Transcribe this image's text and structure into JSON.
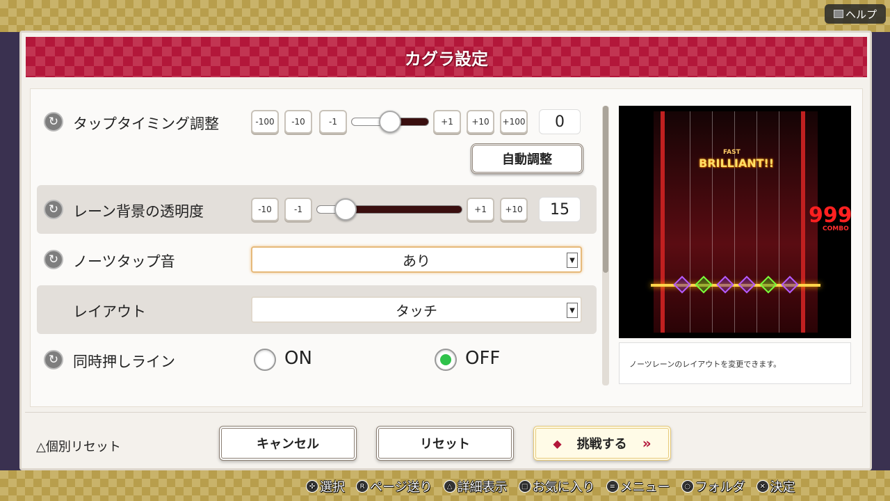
{
  "header": {
    "help_label": "ヘルプ"
  },
  "dialog": {
    "title": "カグラ設定"
  },
  "settings": {
    "tap_timing": {
      "label": "タップタイミング調整",
      "buttons": [
        "-100",
        "-10",
        "-1",
        "+1",
        "+10",
        "+100"
      ],
      "value": "0",
      "slider_fraction": 0.5,
      "auto_button": "自動調整"
    },
    "lane_opacity": {
      "label": "レーン背景の透明度",
      "buttons": [
        "-10",
        "-1",
        "+1",
        "+10"
      ],
      "value": "15",
      "slider_fraction": 0.2
    },
    "note_tap_sound": {
      "label": "ノーツタップ音",
      "value": "あり"
    },
    "layout": {
      "label": "レイアウト",
      "value": "タッチ"
    },
    "simultaneous_line": {
      "label": "同時押しライン",
      "options": [
        "ON",
        "OFF"
      ],
      "selected": "OFF"
    }
  },
  "preview": {
    "judge_timing": "FAST",
    "judge": "BRILLIANT!!",
    "combo_number": "999",
    "combo_label": "COMBO",
    "colors": {
      "lane_edge": "#c02020",
      "note_purple": "#b65cff",
      "note_green": "#7cff3a",
      "judge_line": "#ffd54a"
    }
  },
  "description": "ノーツレーンのレイアウトを変更できます。",
  "footer": {
    "reset_individual": "△個別リセット",
    "cancel_label": "キャンセル",
    "reset_label": "リセット",
    "challenge_label": "挑戦する"
  },
  "controls": [
    {
      "icon": "dpad-icon",
      "glyph": "✣",
      "label": "選択"
    },
    {
      "icon": "lr-buttons-icon",
      "glyph": "R",
      "label": "ページ送り"
    },
    {
      "icon": "triangle-button-icon",
      "glyph": "△",
      "label": "詳細表示"
    },
    {
      "icon": "square-button-icon",
      "glyph": "□",
      "label": "お気に入り"
    },
    {
      "icon": "options-button-icon",
      "glyph": "≡",
      "label": "メニュー"
    },
    {
      "icon": "circle-button-icon",
      "glyph": "○",
      "label": "フォルダ"
    },
    {
      "icon": "cross-button-icon",
      "glyph": "✕",
      "label": "決定"
    }
  ],
  "theme": {
    "accent": "#b3173a",
    "gold": "#c9b36a",
    "radio_on": "#2ec24a"
  }
}
